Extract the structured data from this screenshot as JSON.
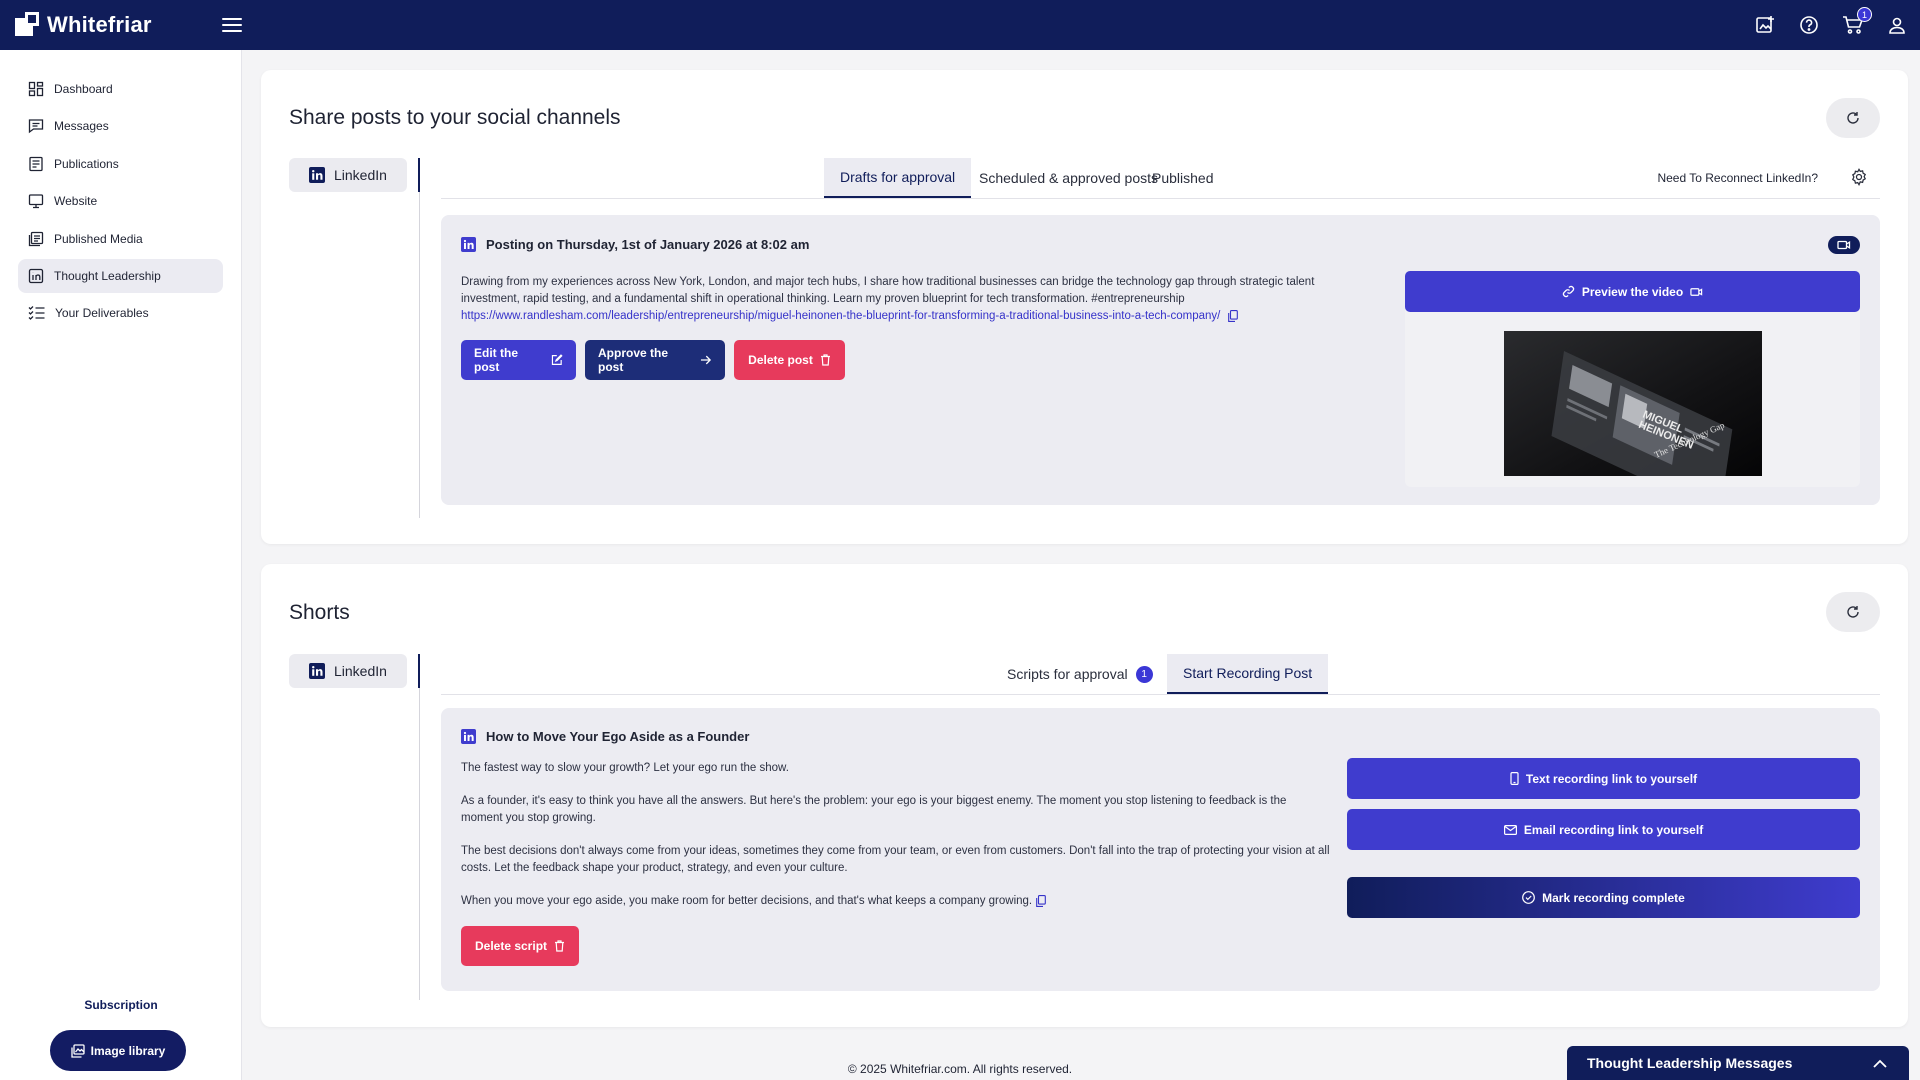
{
  "app": {
    "name": "Whitefriar"
  },
  "topbar": {
    "cart_count": "1"
  },
  "sidebar": {
    "items": [
      {
        "label": "Dashboard",
        "icon": "dashboard-icon"
      },
      {
        "label": "Messages",
        "icon": "messages-icon"
      },
      {
        "label": "Publications",
        "icon": "publications-icon"
      },
      {
        "label": "Website",
        "icon": "monitor-icon"
      },
      {
        "label": "Published Media",
        "icon": "media-icon"
      },
      {
        "label": "Thought Leadership",
        "icon": "linkedin-icon",
        "active": true
      },
      {
        "label": "Your Deliverables",
        "icon": "checklist-icon"
      }
    ],
    "subscription_label": "Subscription",
    "image_library_label": "Image library"
  },
  "social": {
    "title": "Share posts to your social channels",
    "channel": "LinkedIn",
    "tabs": [
      "Drafts for approval",
      "Scheduled & approved posts",
      "Published"
    ],
    "active_tab": "Drafts for approval",
    "reconnect_label": "Need To Reconnect LinkedIn?",
    "post": {
      "heading": "Posting on Thursday, 1st of January 2026 at 8:02 am",
      "body": "Drawing from my experiences across New York, London, and major tech hubs, I share how traditional businesses can bridge the technology gap through strategic talent investment, rapid testing, and a fundamental shift in operational thinking. Learn my proven blueprint for tech transformation. #entrepreneurship",
      "link": "https://www.randlesham.com/leadership/entrepreneurship/miguel-heinonen-the-blueprint-for-transforming-a-traditional-business-into-a-tech-company/",
      "edit_label": "Edit the post",
      "approve_label": "Approve the post",
      "delete_label": "Delete post",
      "preview_label": "Preview the video",
      "thumbnail_text": {
        "name_line1": "MIGUEL",
        "name_line2": "HEINONEN",
        "caption": "The Technology Gap"
      }
    }
  },
  "shorts": {
    "title": "Shorts",
    "channel": "LinkedIn",
    "tabs": [
      {
        "label": "Scripts for approval",
        "badge": "1"
      },
      {
        "label": "Start Recording Post"
      }
    ],
    "active_tab": "Start Recording Post",
    "script": {
      "heading": "How to Move Your Ego Aside as a Founder",
      "paragraphs": [
        "The fastest way to slow your growth? Let your ego run the show.",
        "As a founder, it's easy to think you have all the answers. But here's the problem: your ego is your biggest enemy. The moment you stop listening to feedback is the moment you stop growing.",
        "The best decisions don't always come from your ideas, sometimes they come from your team, or even from customers. Don't fall into the trap of protecting your vision at all costs. Let the feedback shape your product, strategy, and even your culture.",
        "When you move your ego aside, you make room for better decisions, and that's what keeps a company growing."
      ],
      "delete_label": "Delete script",
      "text_link_label": "Text recording link to yourself",
      "email_link_label": "Email recording link to yourself",
      "mark_complete_label": "Mark recording complete"
    }
  },
  "footer": {
    "copyright": "© 2025 Whitefriar.com. All rights reserved."
  },
  "tl_messages": {
    "label": "Thought Leadership Messages"
  },
  "colors": {
    "navy": "#101d5a",
    "primary": "#3f3cce",
    "danger": "#e73a5c",
    "link": "#3532c9"
  }
}
